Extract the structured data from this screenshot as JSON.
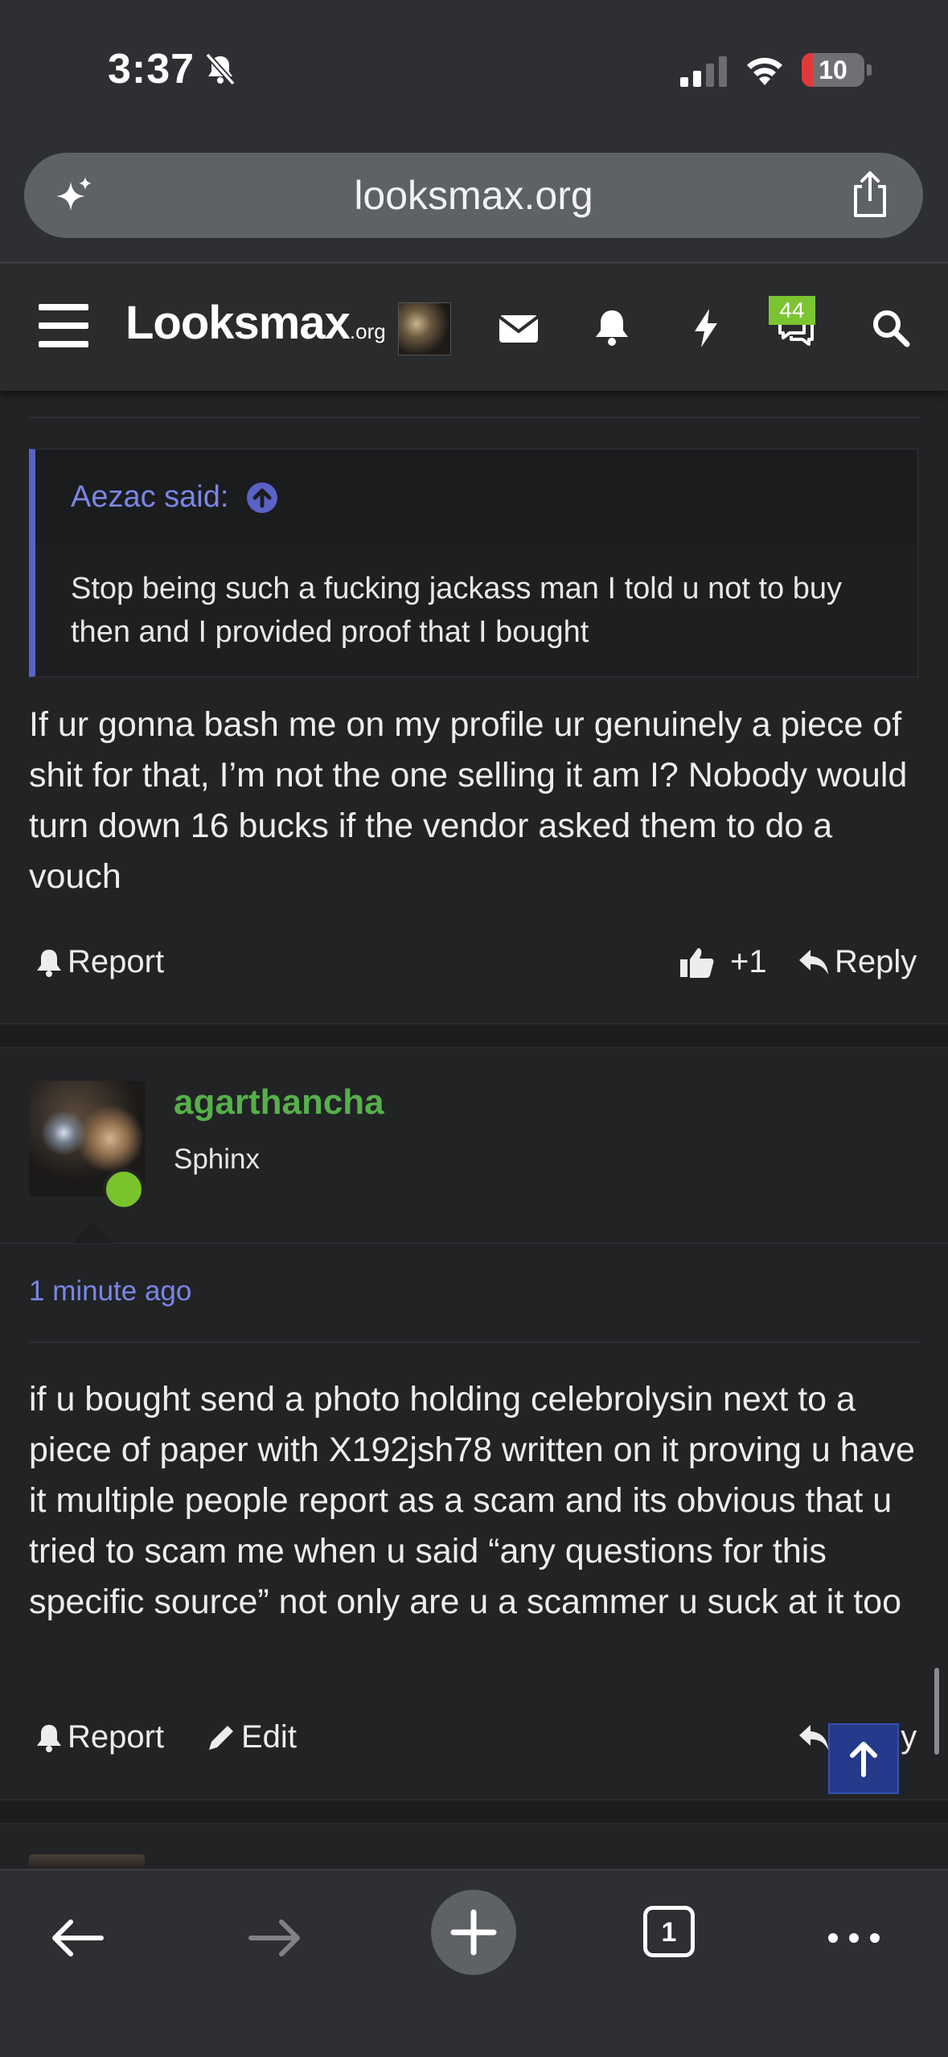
{
  "status_bar": {
    "time": "3:37",
    "battery": "10",
    "icons": [
      "bell-slash-icon",
      "signal-icon",
      "wifi-icon",
      "battery-icon"
    ]
  },
  "browser": {
    "url": "looksmax.org",
    "icons": [
      "sparkle-icon",
      "share-icon"
    ],
    "tab_count": "1"
  },
  "site_nav": {
    "logo_main": "Looksmax",
    "logo_suffix": ".org",
    "conversations_badge": "44",
    "icons": [
      "menu-icon",
      "envelope-icon",
      "bell-icon",
      "bolt-icon",
      "chat-icon",
      "search-icon"
    ]
  },
  "post1": {
    "quote_author": "Aezac said:",
    "quote_text": "Stop being such a fucking jackass man I told u not to buy then and I provided proof that I bought",
    "text": "If ur gonna bash me on my profile ur genuinely a piece of shit for that, I’m not the one selling it am I? Nobody would turn down 16 bucks if the vendor asked them to do a vouch",
    "report_label": "Report",
    "reaction_count": "+1",
    "reply_label": "Reply"
  },
  "post2": {
    "username": "agarthancha",
    "user_title": "Sphinx",
    "time": "1 minute ago",
    "text": "if u bought send a photo holding celebrolysin next to a piece of paper with X192jsh78 written on it proving u have it multiple people report as a scam and its obvious that u tried to scam me when u said “any questions for this specific source” not only are u a scammer u suck at it too",
    "report_label": "Report",
    "edit_label": "Edit",
    "reply_label": "Reply"
  },
  "colors": {
    "background": "#222325",
    "accent_link": "#7a86e6",
    "username_green": "#56b04a",
    "badge_green": "#7bc432",
    "quote_border": "#5a62c8"
  }
}
